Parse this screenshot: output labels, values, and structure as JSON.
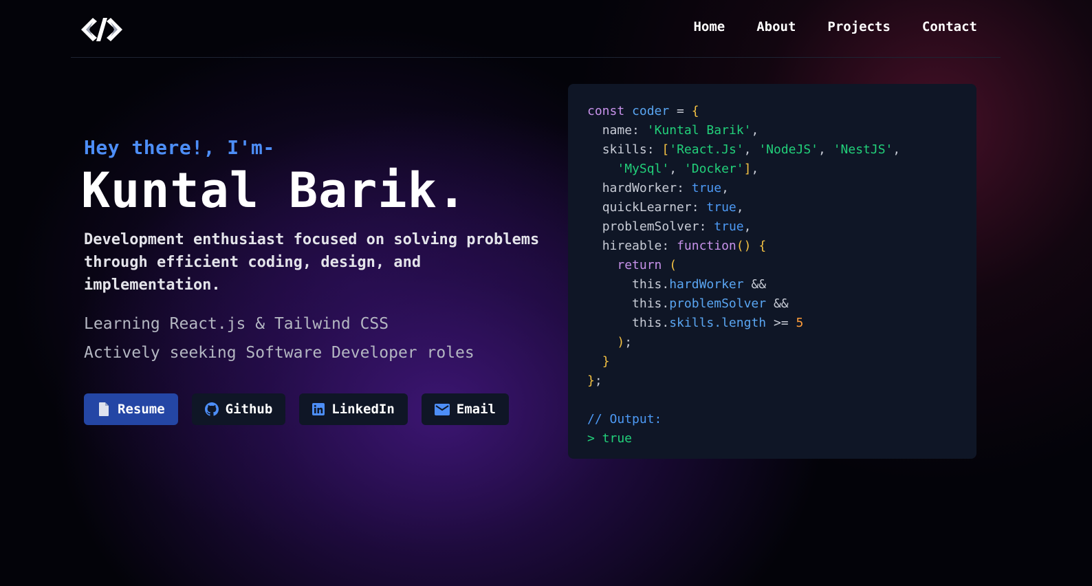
{
  "nav": {
    "logo_icon": "code-brackets-icon",
    "links": [
      "Home",
      "About",
      "Projects",
      "Contact"
    ]
  },
  "hero": {
    "greeting": "Hey there!, I'm-",
    "name": "Kuntal Barik.",
    "tagline": "Development enthusiast focused on solving problems through efficient coding, design, and implementation.",
    "learning": "Learning React.js & Tailwind CSS",
    "seeking": "Actively seeking Software Developer roles"
  },
  "buttons": [
    {
      "label": "Resume",
      "icon": "document-icon"
    },
    {
      "label": "Github",
      "icon": "github-icon"
    },
    {
      "label": "LinkedIn",
      "icon": "linkedin-icon"
    },
    {
      "label": "Email",
      "icon": "mail-icon"
    }
  ],
  "code": {
    "const_kw": "const",
    "var_name": "coder",
    "name_key": "name",
    "name_val": "'Kuntal Barik'",
    "skills_key": "skills",
    "skills": [
      "'React.Js'",
      "'NodeJS'",
      "'NestJS'",
      "'MySql'",
      "'Docker'"
    ],
    "hardworker_key": "hardWorker",
    "quicklearner_key": "quickLearner",
    "problemsolver_key": "problemSolver",
    "hireable_key": "hireable",
    "function_kw": "function",
    "return_kw": "return",
    "true_val": "true",
    "this_kw": "this.",
    "skills_prop": "skills",
    "length_prop": "length",
    "and_op": "&&",
    "gte_op": ">=",
    "five": "5",
    "comment": "// Output:",
    "output": "> true"
  },
  "colors": {
    "accent_blue": "#4d8ef7",
    "primary_button": "#2446a5",
    "card_bg": "#0f1626",
    "string_green": "#22d07a",
    "keyword_purple": "#c792ea",
    "bracket_yellow": "#f5c243"
  }
}
